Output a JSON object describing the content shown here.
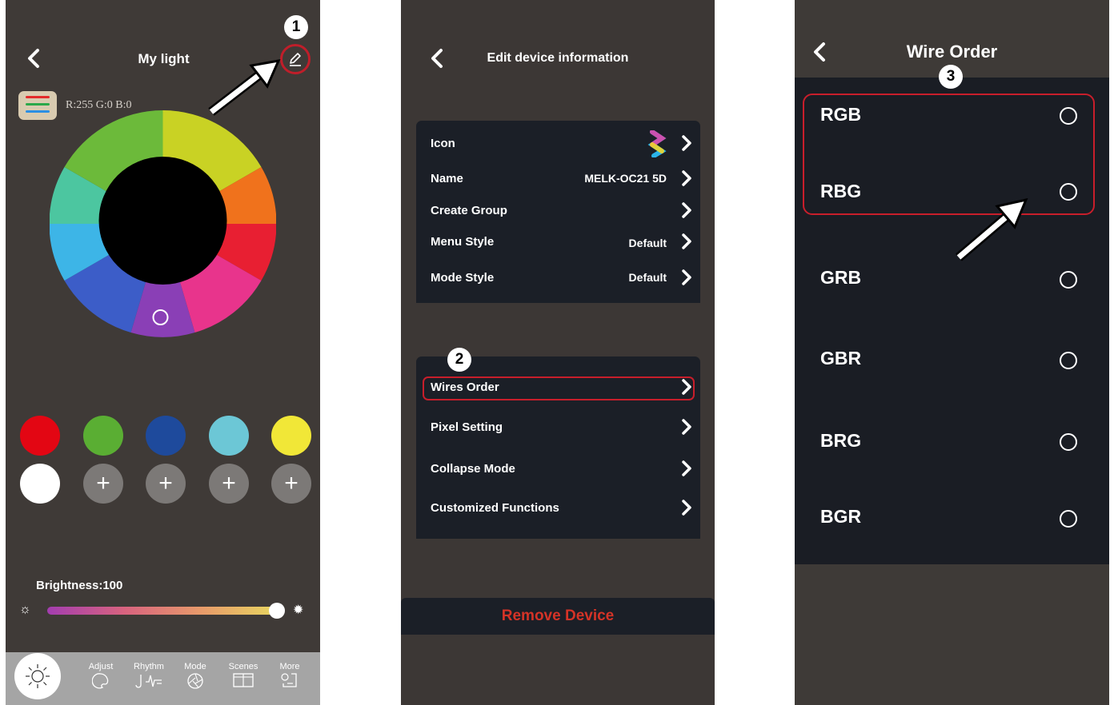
{
  "panel1": {
    "title": "My light",
    "rgb_readout": "R:255 G:0 B:0",
    "step": "1",
    "preset_colors": [
      "#e30613",
      "#5aae33",
      "#1e4a9c",
      "#6cc7d6",
      "#f1e737",
      "#ffffff"
    ],
    "add_label": "+",
    "brightness_label": "Brightness:100",
    "brightness_value": 100,
    "nav": {
      "adjust": "Adjust",
      "rhythm": "Rhythm",
      "mode": "Mode",
      "scenes": "Scenes",
      "more": "More"
    }
  },
  "panel2": {
    "title": "Edit device information",
    "step": "2",
    "section1": [
      {
        "label": "Icon",
        "value": ""
      },
      {
        "label": "Name",
        "value": "MELK-OC21 5D"
      },
      {
        "label": "Create Group",
        "value": ""
      },
      {
        "label": "Menu Style",
        "value": "Default"
      },
      {
        "label": "Mode Style",
        "value": "Default"
      }
    ],
    "section2": [
      {
        "label": "Wires Order"
      },
      {
        "label": "Pixel Setting"
      },
      {
        "label": "Collapse Mode"
      },
      {
        "label": "Customized Functions"
      }
    ],
    "remove_label": "Remove Device"
  },
  "panel3": {
    "title": "Wire Order",
    "step": "3",
    "options": [
      "RGB",
      "RBG",
      "GRB",
      "GBR",
      "BRG",
      "BGR"
    ]
  },
  "colors": {
    "highlight": "#c81e2b",
    "card": "#1b1f27",
    "remove_text": "#d43327"
  }
}
